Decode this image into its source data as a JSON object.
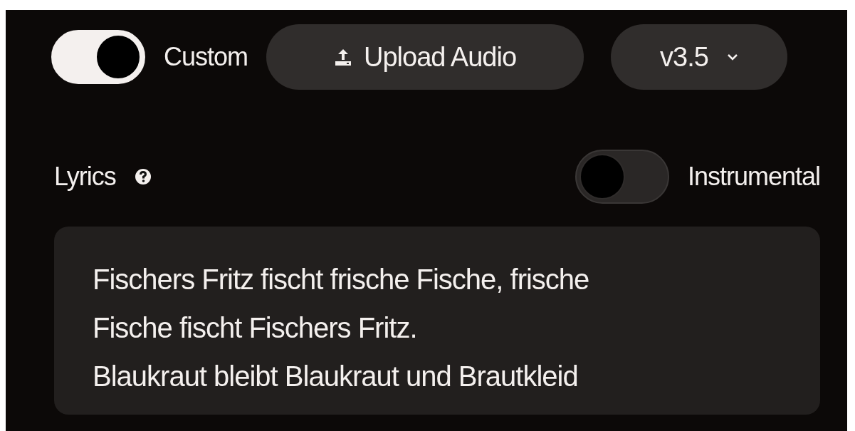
{
  "mode_toggle": {
    "label": "Custom",
    "on": true
  },
  "upload_button": {
    "label": "Upload Audio"
  },
  "version_select": {
    "value": "v3.5"
  },
  "lyrics": {
    "label": "Lyrics",
    "instrumental_toggle": {
      "label": "Instrumental",
      "on": false
    },
    "lines": [
      "Fischers Fritz fischt frische Fische, frische",
      "Fische fischt Fischers Fritz.",
      "Blaukraut bleibt Blaukraut und Brautkleid"
    ]
  }
}
